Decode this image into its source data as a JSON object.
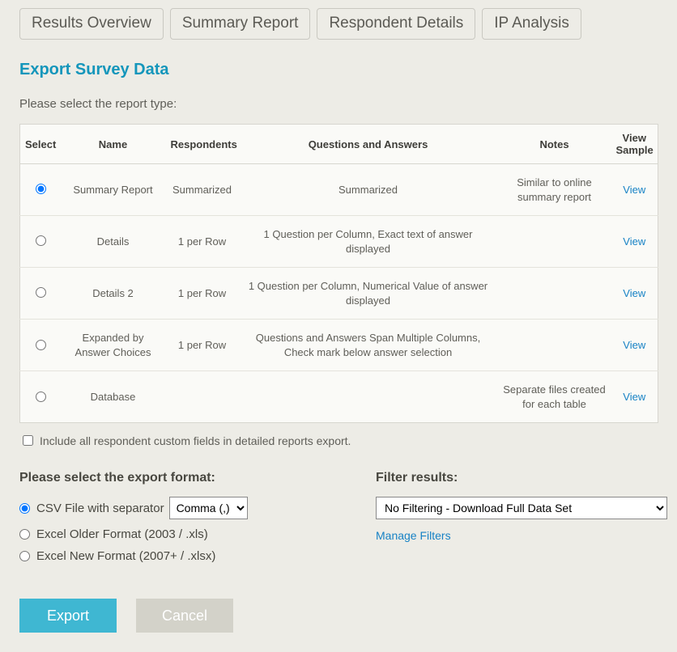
{
  "tabs": [
    "Results Overview",
    "Summary Report",
    "Respondent Details",
    "IP Analysis"
  ],
  "page_title": "Export Survey Data",
  "prompt": "Please select the report type:",
  "headers": {
    "select": "Select",
    "name": "Name",
    "respondents": "Respondents",
    "qa": "Questions and Answers",
    "notes": "Notes",
    "view_sample": "View Sample"
  },
  "rows": [
    {
      "name": "Summary Report",
      "respondents": "Summarized",
      "qa": "Summarized",
      "notes": "Similar to online summary report",
      "view": "View",
      "checked": true
    },
    {
      "name": "Details",
      "respondents": "1 per Row",
      "qa": "1 Question per Column, Exact text of answer displayed",
      "notes": "",
      "view": "View",
      "checked": false
    },
    {
      "name": "Details 2",
      "respondents": "1 per Row",
      "qa": "1 Question per Column, Numerical Value of answer displayed",
      "notes": "",
      "view": "View",
      "checked": false
    },
    {
      "name": "Expanded by Answer Choices",
      "respondents": "1 per Row",
      "qa": "Questions and Answers Span Multiple Columns, Check mark below answer selection",
      "notes": "",
      "view": "View",
      "checked": false
    },
    {
      "name": "Database",
      "respondents": "",
      "qa": "",
      "notes": "Separate files created for each table",
      "view": "View",
      "checked": false
    }
  ],
  "include_label": "Include all respondent custom fields in detailed reports export.",
  "format_heading": "Please select the export format:",
  "format_options": {
    "csv": "CSV File with separator",
    "excel_old": "Excel Older Format (2003 / .xls)",
    "excel_new": "Excel New Format (2007+ / .xlsx)"
  },
  "separator_selected": "Comma (,)",
  "filter_heading": "Filter results:",
  "filter_selected": "No Filtering - Download Full Data Set",
  "manage_filters": "Manage Filters",
  "buttons": {
    "export": "Export",
    "cancel": "Cancel"
  }
}
